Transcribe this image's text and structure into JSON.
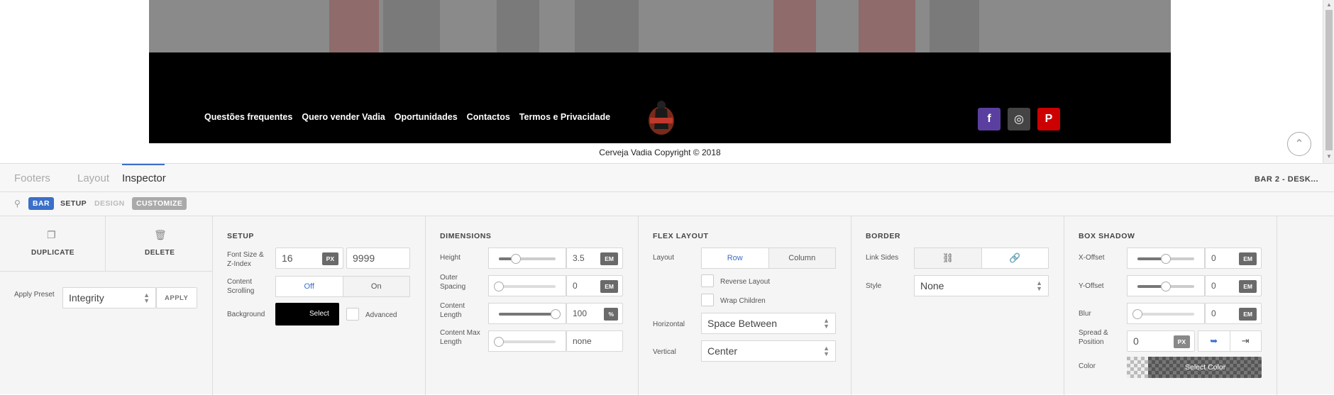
{
  "site": {
    "nav": [
      "Questões frequentes",
      "Quero vender Vadia",
      "Oportunidades",
      "Contactos",
      "Termos e Privacidade"
    ],
    "social": [
      {
        "icon": "facebook-icon",
        "glyph": "f",
        "color": "#5b3fa0"
      },
      {
        "icon": "instagram-icon",
        "glyph": "◎",
        "color": "#444444"
      },
      {
        "icon": "pinterest-icon",
        "glyph": "P",
        "color": "#cc0000"
      }
    ],
    "copyright": "Cerveja Vadia Copyright © 2018",
    "scroll_top_glyph": "⌃"
  },
  "panel": {
    "tabs": [
      "Footers",
      "Layout",
      "Inspector"
    ],
    "active_tab": "Inspector",
    "title_right": "BAR 2 - DESK...",
    "crumbs": [
      "BAR",
      "SETUP",
      "DESIGN",
      "CUSTOMIZE"
    ],
    "accent": "#3b6fc9"
  },
  "actions": {
    "duplicate": "DUPLICATE",
    "delete": "DELETE",
    "apply_preset_label": "Apply Preset",
    "preset_value": "Integrity",
    "apply": "APPLY"
  },
  "setup": {
    "title": "SETUP",
    "font_size_label": "Font Size & Z-Index",
    "font_size": "16",
    "font_unit": "PX",
    "z_index": "9999",
    "scrolling_label": "Content Scrolling",
    "scrolling_off": "Off",
    "scrolling_on": "On",
    "background_label": "Background",
    "background_button": "Select",
    "advanced_label": "Advanced"
  },
  "dimensions": {
    "title": "DIMENSIONS",
    "height_label": "Height",
    "height_value": "3.5",
    "height_unit": "EM",
    "height_level": 0.3,
    "outer_label": "Outer Spacing",
    "outer_value": "0",
    "outer_unit": "EM",
    "outer_level": 0,
    "length_label": "Content Length",
    "length_value": "100",
    "length_unit": "%",
    "length_level": 1,
    "maxlen_label": "Content Max Length",
    "maxlen_value": "none",
    "maxlen_level": 0
  },
  "flex": {
    "title": "FLEX LAYOUT",
    "layout_label": "Layout",
    "row": "Row",
    "column": "Column",
    "reverse": "Reverse Layout",
    "wrap": "Wrap Children",
    "horizontal_label": "Horizontal",
    "horizontal_value": "Space Between",
    "vertical_label": "Vertical",
    "vertical_value": "Center"
  },
  "border": {
    "title": "BORDER",
    "link_label": "Link Sides",
    "style_label": "Style",
    "style_value": "None"
  },
  "shadow": {
    "title": "BOX SHADOW",
    "x_label": "X-Offset",
    "x_value": "0",
    "x_level": 0.5,
    "y_label": "Y-Offset",
    "y_value": "0",
    "y_level": 0.5,
    "blur_label": "Blur",
    "blur_value": "0",
    "blur_level": 0,
    "unit": "EM",
    "spread_label": "Spread & Position",
    "spread_value": "0",
    "spread_unit": "PX",
    "color_label": "Color",
    "color_button": "Select Color"
  }
}
